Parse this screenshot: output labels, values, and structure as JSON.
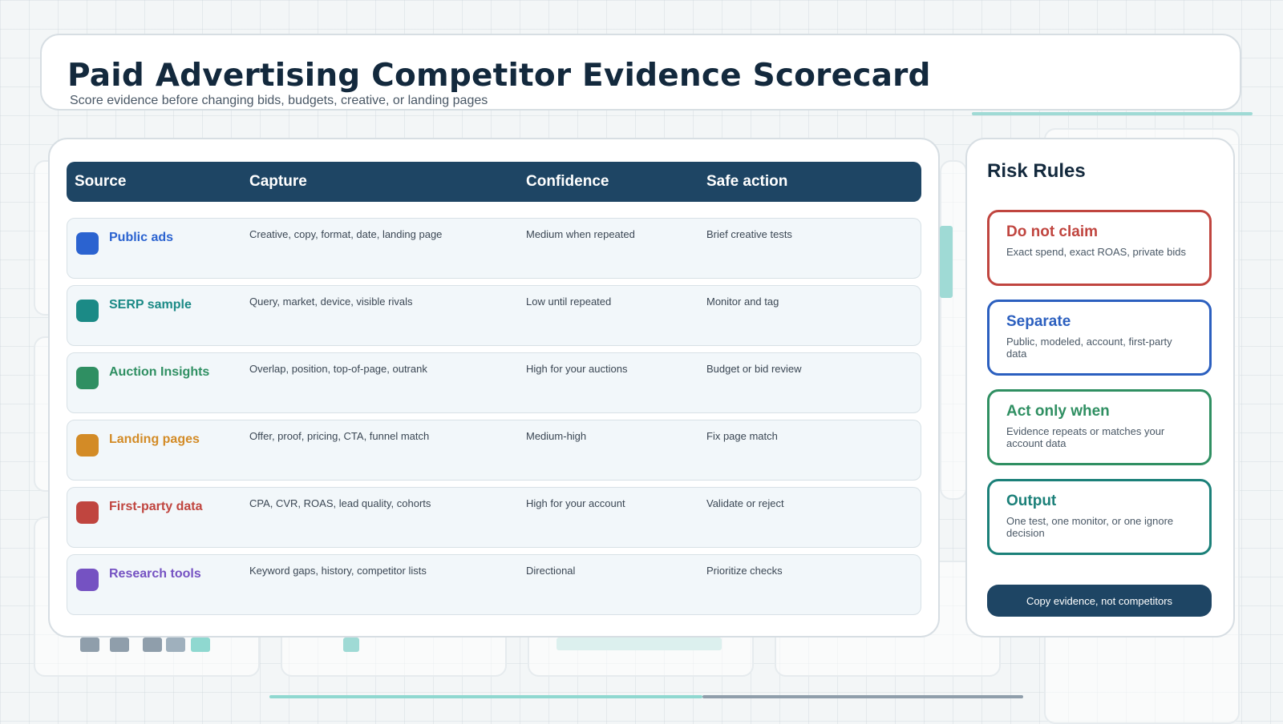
{
  "header": {
    "title": "Paid Advertising Competitor Evidence Scorecard",
    "subtitle": "Score evidence before changing bids, budgets, creative, or landing pages"
  },
  "table": {
    "columns": [
      "Source",
      "Capture",
      "Confidence",
      "Safe action"
    ],
    "rows": [
      {
        "source": "Public ads",
        "capture": "Creative, copy, format, date, landing page",
        "confidence": "Medium when repeated",
        "action": "Brief creative tests",
        "color": "#2b63d0"
      },
      {
        "source": "SERP sample",
        "capture": "Query, market, device, visible rivals",
        "confidence": "Low until repeated",
        "action": "Monitor and tag",
        "color": "#1b8a86"
      },
      {
        "source": "Auction Insights",
        "capture": "Overlap, position, top-of-page, outrank",
        "confidence": "High for your auctions",
        "action": "Budget or bid review",
        "color": "#2f8f62"
      },
      {
        "source": "Landing pages",
        "capture": "Offer, proof, pricing, CTA, funnel match",
        "confidence": "Medium-high",
        "action": "Fix page match",
        "color": "#d38b26"
      },
      {
        "source": "First-party data",
        "capture": "CPA, CVR, ROAS, lead quality, cohorts",
        "confidence": "High for your account",
        "action": "Validate or reject",
        "color": "#c0453f"
      },
      {
        "source": "Research tools",
        "capture": "Keyword gaps, history, competitor lists",
        "confidence": "Directional",
        "action": "Prioritize checks",
        "color": "#7552c2"
      }
    ]
  },
  "risk_rules": {
    "title": "Risk Rules",
    "items": [
      {
        "title": "Do not claim",
        "text": "Exact spend, exact ROAS, private bids",
        "color": "#c0453f"
      },
      {
        "title": "Separate",
        "text": "Public, modeled, account, first-party data",
        "color": "#2b5fbf"
      },
      {
        "title": "Act only when",
        "text": "Evidence repeats or matches your account data",
        "color": "#2f8f62"
      },
      {
        "title": "Output",
        "text": "One test, one monitor, or one ignore decision",
        "color": "#1b8079"
      }
    ],
    "button_label": "Copy evidence, not competitors"
  },
  "colors": {
    "navy": "#1e4564",
    "teal_accent": "#9fdad5"
  }
}
